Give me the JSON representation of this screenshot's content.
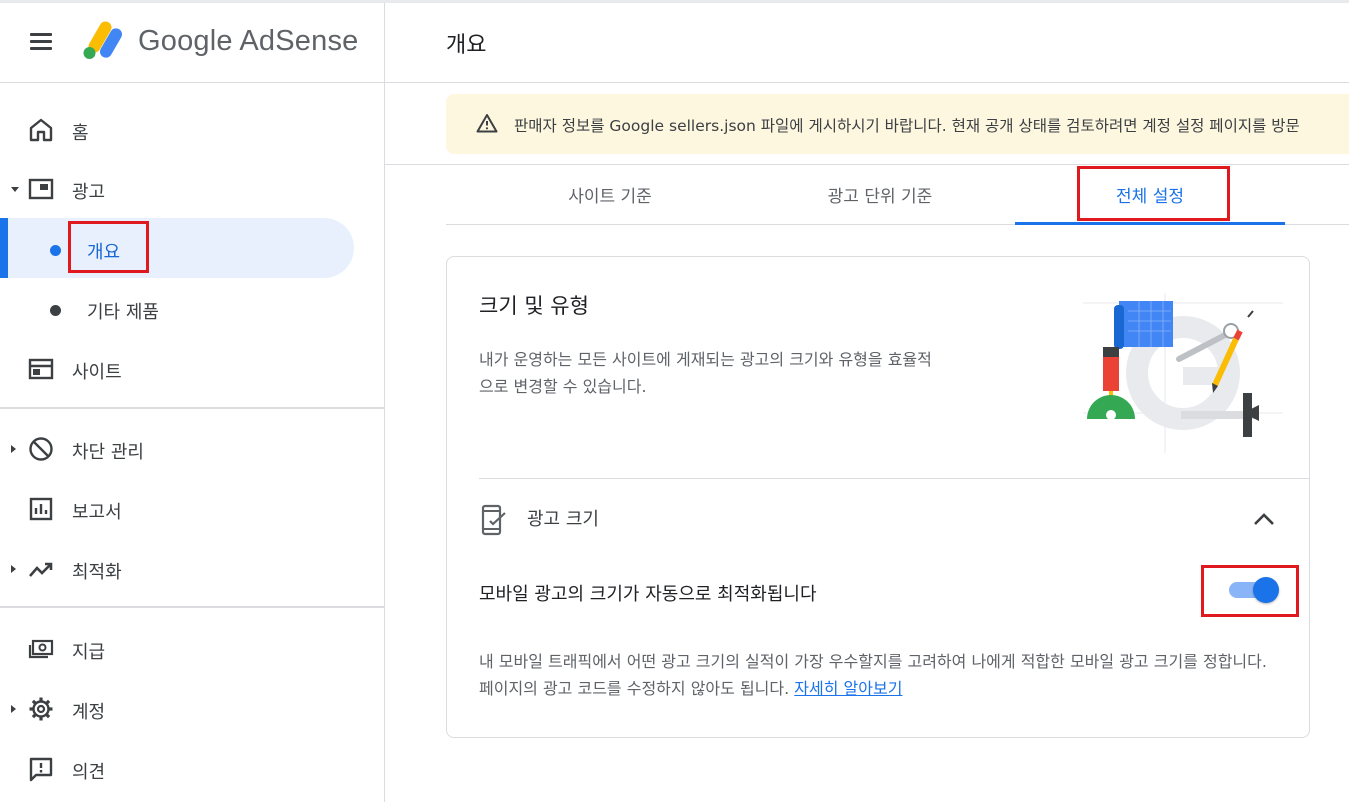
{
  "app": {
    "brand": "Google AdSense",
    "menu_icon": "hamburger-menu-icon",
    "logo_icon": "adsense-logo-icon"
  },
  "sidebar": {
    "items": [
      {
        "label": "홈",
        "icon": "home-icon"
      },
      {
        "label": "광고",
        "icon": "ads-icon",
        "expanded": true
      },
      {
        "label": "개요",
        "sub": true,
        "selected": true
      },
      {
        "label": "기타 제품",
        "sub": true
      },
      {
        "label": "사이트",
        "icon": "sites-icon"
      },
      {
        "label": "차단 관리",
        "icon": "block-icon",
        "expandable": true
      },
      {
        "label": "보고서",
        "icon": "reports-icon"
      },
      {
        "label": "최적화",
        "icon": "trending-icon",
        "expandable": true
      },
      {
        "label": "지급",
        "icon": "payments-icon"
      },
      {
        "label": "계정",
        "icon": "gear-icon",
        "expandable": true
      },
      {
        "label": "의견",
        "icon": "feedback-icon"
      }
    ]
  },
  "header": {
    "title": "개요"
  },
  "banner": {
    "icon": "warning-icon",
    "text": "판매자 정보를 Google sellers.json 파일에 게시하시기 바랍니다. 현재 공개 상태를 검토하려면 계정 설정 페이지를 방문"
  },
  "tabs": [
    {
      "label": "사이트 기준"
    },
    {
      "label": "광고 단위 기준"
    },
    {
      "label": "전체 설정",
      "active": true
    }
  ],
  "card": {
    "title": "크기 및 유형",
    "description": "내가 운영하는 모든 사이트에 게재되는 광고의 크기와 유형을 효율적으로 변경할 수 있습니다.",
    "illustration": "design-tools-illustration",
    "section": {
      "icon": "mobile-check-icon",
      "title": "광고 크기",
      "expanded": true
    },
    "option": {
      "label": "모바일 광고의 크기가 자동으로 최적화됩니다",
      "enabled": true,
      "description": "내 모바일 트래픽에서 어떤 광고 크기의 실적이 가장 우수할지를 고려하여 나에게 적합한 모바일 광고 크기를 정합니다. 페이지의 광고 코드를 수정하지 않아도 됩니다.",
      "link": "자세히 알아보기"
    }
  },
  "colors": {
    "accent": "#1a73e8",
    "highlight_box": "#e0191f",
    "banner_bg": "#fef7e0"
  }
}
